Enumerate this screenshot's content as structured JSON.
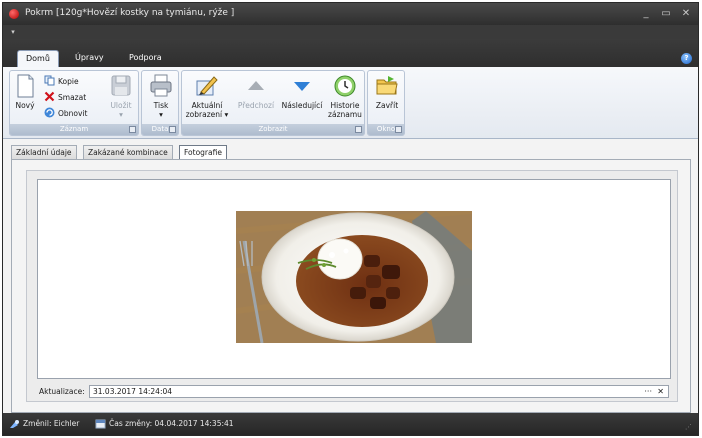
{
  "window": {
    "title": "Pokrm [120g*Hovězí kostky na tymiánu, rýže ]",
    "controls": [
      "_",
      "▭",
      "✕"
    ]
  },
  "quick_access": {
    "menu_glyph": "▾"
  },
  "ribbon_tabs": [
    {
      "label": "Domů",
      "active": true
    },
    {
      "label": "Úpravy",
      "active": false
    },
    {
      "label": "Podpora",
      "active": false
    }
  ],
  "help_glyph": "?",
  "groups": {
    "zaznam": {
      "label": "Záznam",
      "new": "Nový",
      "copy": "Kopie",
      "delete": "Smazat",
      "refresh": "Obnovit",
      "save": "Uložit"
    },
    "data": {
      "label": "Data",
      "print": "Tisk",
      "print_arrow": "▾"
    },
    "zobrazit": {
      "label": "Zobrazit",
      "current_view_line1": "Aktuální",
      "current_view_line2": "zobrazení ▾",
      "previous": "Předchozí",
      "next": "Následující",
      "history_line1": "Historie",
      "history_line2": "záznamu"
    },
    "okno": {
      "label": "Okno",
      "close": "Zavřít"
    }
  },
  "content_tabs": [
    {
      "label": "Základní údaje",
      "active": false
    },
    {
      "label": "Zakázané kombinace",
      "active": false
    },
    {
      "label": "Fotografie",
      "active": true
    }
  ],
  "update": {
    "label": "Aktualizace:",
    "value": "31.03.2017 14:24:04",
    "more_glyph": "···",
    "clear_glyph": "✕"
  },
  "status": {
    "changed_by": "Změnil: Eichler",
    "changed_time": "Čas změny: 04.04.2017 14:35:41"
  },
  "colors": {
    "titlebar": "#3a3a3a",
    "ribbon": "#e9eef5",
    "group_label": "#aebcce",
    "status": "#2e2e2e"
  }
}
